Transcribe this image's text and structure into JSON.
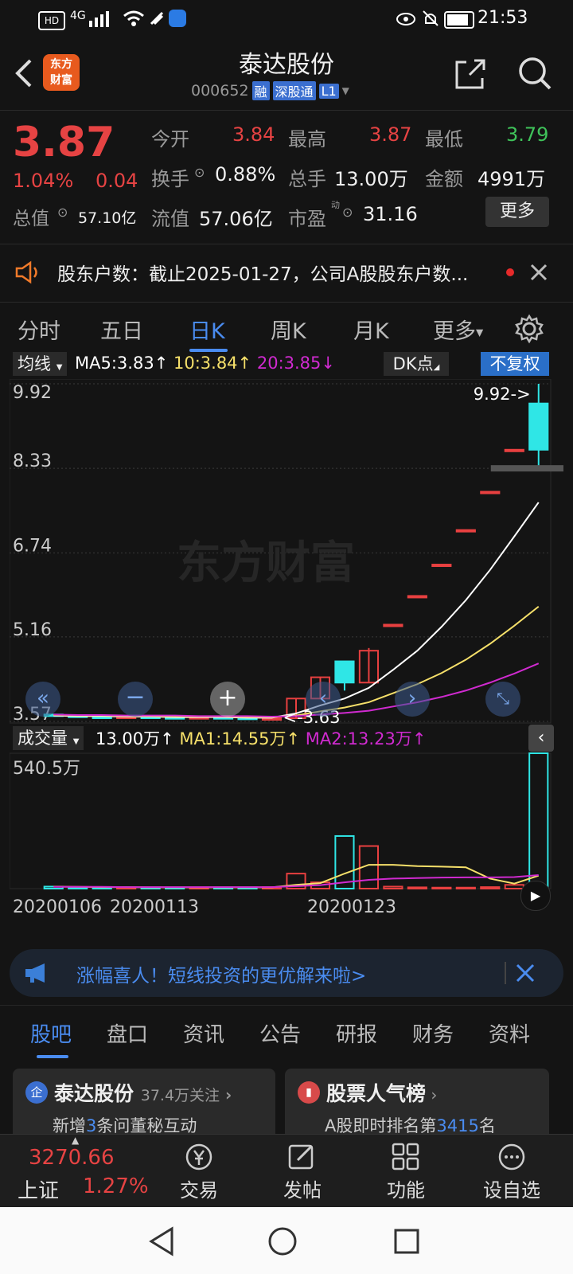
{
  "status": {
    "time": "21:53",
    "network": "4G"
  },
  "header": {
    "title": "泰达股份",
    "code": "000652",
    "badge_rong": "融",
    "badge_sgt": "深股通",
    "badge_l1": "L1",
    "logo_top": "东方",
    "logo_bottom": "财富"
  },
  "quote": {
    "price": "3.87",
    "pct": "1.04%",
    "chg": "0.04",
    "open_label": "今开",
    "open": "3.84",
    "high_label": "最高",
    "high": "3.87",
    "low_label": "最低",
    "low": "3.79",
    "turnover_label": "换手",
    "turnover": "0.88%",
    "vol_label": "总手",
    "vol": "13.00万",
    "amount_label": "金额",
    "amount": "4991万",
    "mcap_label": "总值",
    "mcap": "57.10亿",
    "float_label": "流值",
    "float": "57.06亿",
    "pe_label": "市盈",
    "pe_sup": "动",
    "pe": "31.16",
    "more": "更多"
  },
  "news": {
    "text": "股东户数：截止2025-01-27，公司A股股东户数..."
  },
  "tabs": [
    "分时",
    "五日",
    "日K",
    "周K",
    "月K",
    "更多"
  ],
  "chart_top": {
    "ma_select": "均线",
    "ma5": "MA5:3.83",
    "ma10": "10:3.84",
    "ma20": "20:3.85",
    "dk": "DK点",
    "fq": "不复权",
    "y_labels": [
      "9.92",
      "8.33",
      "6.74",
      "5.16",
      "3.57"
    ],
    "max_label": "9.92->",
    "min_label": "<-3.63",
    "watermark": "东方财富"
  },
  "chart_vol": {
    "select": "成交量",
    "vol": "13.00万",
    "ma1": "MA1:14.55万",
    "ma2": "MA2:13.23万",
    "max": "540.5万",
    "dates": [
      "20200106",
      "20200113",
      "20200123"
    ]
  },
  "chart_data": {
    "type": "candlestick",
    "candles": [
      {
        "o": 3.7,
        "c": 3.68,
        "h": 3.71,
        "l": 3.66
      },
      {
        "o": 3.68,
        "c": 3.66,
        "h": 3.7,
        "l": 3.65
      },
      {
        "o": 3.66,
        "c": 3.65,
        "h": 3.68,
        "l": 3.64
      },
      {
        "o": 3.65,
        "c": 3.66,
        "h": 3.67,
        "l": 3.64
      },
      {
        "o": 3.66,
        "c": 3.65,
        "h": 3.67,
        "l": 3.64
      },
      {
        "o": 3.65,
        "c": 3.64,
        "h": 3.66,
        "l": 3.63
      },
      {
        "o": 3.64,
        "c": 3.65,
        "h": 3.66,
        "l": 3.63
      },
      {
        "o": 3.65,
        "c": 3.64,
        "h": 3.65,
        "l": 3.63
      },
      {
        "o": 3.64,
        "c": 3.63,
        "h": 3.65,
        "l": 3.63
      },
      {
        "o": 3.63,
        "c": 3.63,
        "h": 3.64,
        "l": 3.63
      },
      {
        "o": 3.63,
        "c": 4.0,
        "h": 4.0,
        "l": 3.63
      },
      {
        "o": 4.0,
        "c": 4.4,
        "h": 4.4,
        "l": 4.0
      },
      {
        "o": 4.7,
        "c": 4.3,
        "h": 4.7,
        "l": 4.15
      },
      {
        "o": 4.3,
        "c": 4.9,
        "h": 4.95,
        "l": 4.3
      },
      {
        "o": 5.39,
        "c": 5.39,
        "h": 5.39,
        "l": 5.39
      },
      {
        "o": 5.93,
        "c": 5.93,
        "h": 5.93,
        "l": 5.93
      },
      {
        "o": 6.52,
        "c": 6.52,
        "h": 6.52,
        "l": 6.52
      },
      {
        "o": 7.17,
        "c": 7.17,
        "h": 7.17,
        "l": 7.17
      },
      {
        "o": 7.89,
        "c": 7.89,
        "h": 7.89,
        "l": 7.89
      },
      {
        "o": 8.68,
        "c": 8.68,
        "h": 8.68,
        "l": 8.68
      },
      {
        "o": 9.55,
        "c": 8.68,
        "h": 9.92,
        "l": 8.33
      }
    ],
    "ma5": [
      3.68,
      3.67,
      3.67,
      3.66,
      3.66,
      3.65,
      3.65,
      3.65,
      3.64,
      3.64,
      3.72,
      3.87,
      4.0,
      4.2,
      4.54,
      4.9,
      5.35,
      5.85,
      6.42,
      7.05,
      7.69
    ],
    "ma10": [
      3.69,
      3.68,
      3.68,
      3.67,
      3.67,
      3.66,
      3.66,
      3.66,
      3.65,
      3.65,
      3.68,
      3.76,
      3.83,
      3.93,
      4.1,
      4.27,
      4.48,
      4.73,
      5.03,
      5.37,
      5.73
    ],
    "ma20": [
      3.7,
      3.69,
      3.69,
      3.68,
      3.68,
      3.68,
      3.67,
      3.67,
      3.67,
      3.66,
      3.67,
      3.7,
      3.73,
      3.77,
      3.85,
      3.93,
      4.03,
      4.15,
      4.3,
      4.47,
      4.66
    ],
    "volumes": [
      8,
      6,
      5,
      4,
      5,
      4,
      4,
      5,
      5,
      6,
      60,
      25,
      210,
      170,
      8,
      5,
      4,
      4,
      6,
      15,
      540.5
    ],
    "vol_ma1": [
      8,
      7,
      6,
      6,
      5,
      5,
      5,
      5,
      5,
      5,
      15,
      22,
      60,
      95,
      95,
      90,
      88,
      85,
      40,
      20,
      52
    ],
    "vol_ma2": [
      7,
      7,
      7,
      6,
      6,
      6,
      6,
      6,
      6,
      6,
      10,
      14,
      25,
      35,
      40,
      42,
      44,
      45,
      45,
      46,
      54
    ]
  },
  "promo": {
    "text": "涨幅喜人！短线投资的更优解来啦>"
  },
  "subtabs": [
    "股吧",
    "盘口",
    "资讯",
    "公告",
    "研报",
    "财务",
    "资料"
  ],
  "cards": {
    "left_title": "泰达股份",
    "left_follow": "37.4万关注",
    "left_sub_a": "新增",
    "left_sub_num": "3",
    "left_sub_b": "条问董秘互动",
    "right_title": "股票人气榜",
    "right_sub_a": "A股即时排名第",
    "right_sub_num": "3415",
    "right_sub_b": "名"
  },
  "bottom": {
    "index_value": "3270.66",
    "index_name": "上证",
    "index_pct": "1.27%",
    "trade": "交易",
    "post": "发帖",
    "func": "功能",
    "watch": "设自选"
  }
}
